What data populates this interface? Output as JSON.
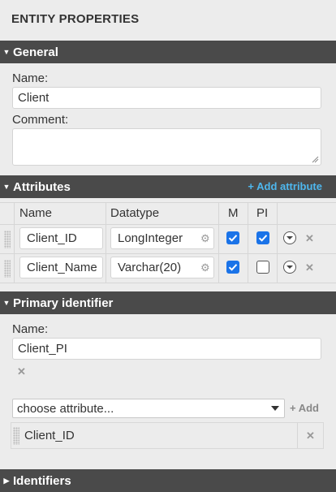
{
  "panel": {
    "title": "ENTITY PROPERTIES"
  },
  "general": {
    "header": "General",
    "name_label": "Name:",
    "name_value": "Client",
    "comment_label": "Comment:",
    "comment_value": ""
  },
  "attributes": {
    "header": "Attributes",
    "add_label": "+ Add attribute",
    "columns": {
      "name": "Name",
      "datatype": "Datatype",
      "m": "M",
      "pi": "PI"
    },
    "rows": [
      {
        "name": "Client_ID",
        "datatype": "LongInteger",
        "m": true,
        "pi": true
      },
      {
        "name": "Client_Name",
        "datatype": "Varchar(20)",
        "m": true,
        "pi": false
      }
    ]
  },
  "primary_identifier": {
    "header": "Primary identifier",
    "name_label": "Name:",
    "name_value": "Client_PI",
    "select_placeholder": "choose attribute...",
    "add_label": "+ Add",
    "attributes": [
      "Client_ID"
    ]
  },
  "identifiers": {
    "header": "Identifiers"
  },
  "icons": {
    "caret": "caret-down-icon",
    "gear": "gear-icon",
    "remove": "close-icon",
    "expand": "chevron-circle-icon",
    "grip": "drag-handle-icon"
  },
  "colors": {
    "header_bg": "#4a4a4a",
    "accent": "#4eb7ee",
    "checkbox_on": "#1a73e8",
    "panel_bg": "#ececec"
  }
}
